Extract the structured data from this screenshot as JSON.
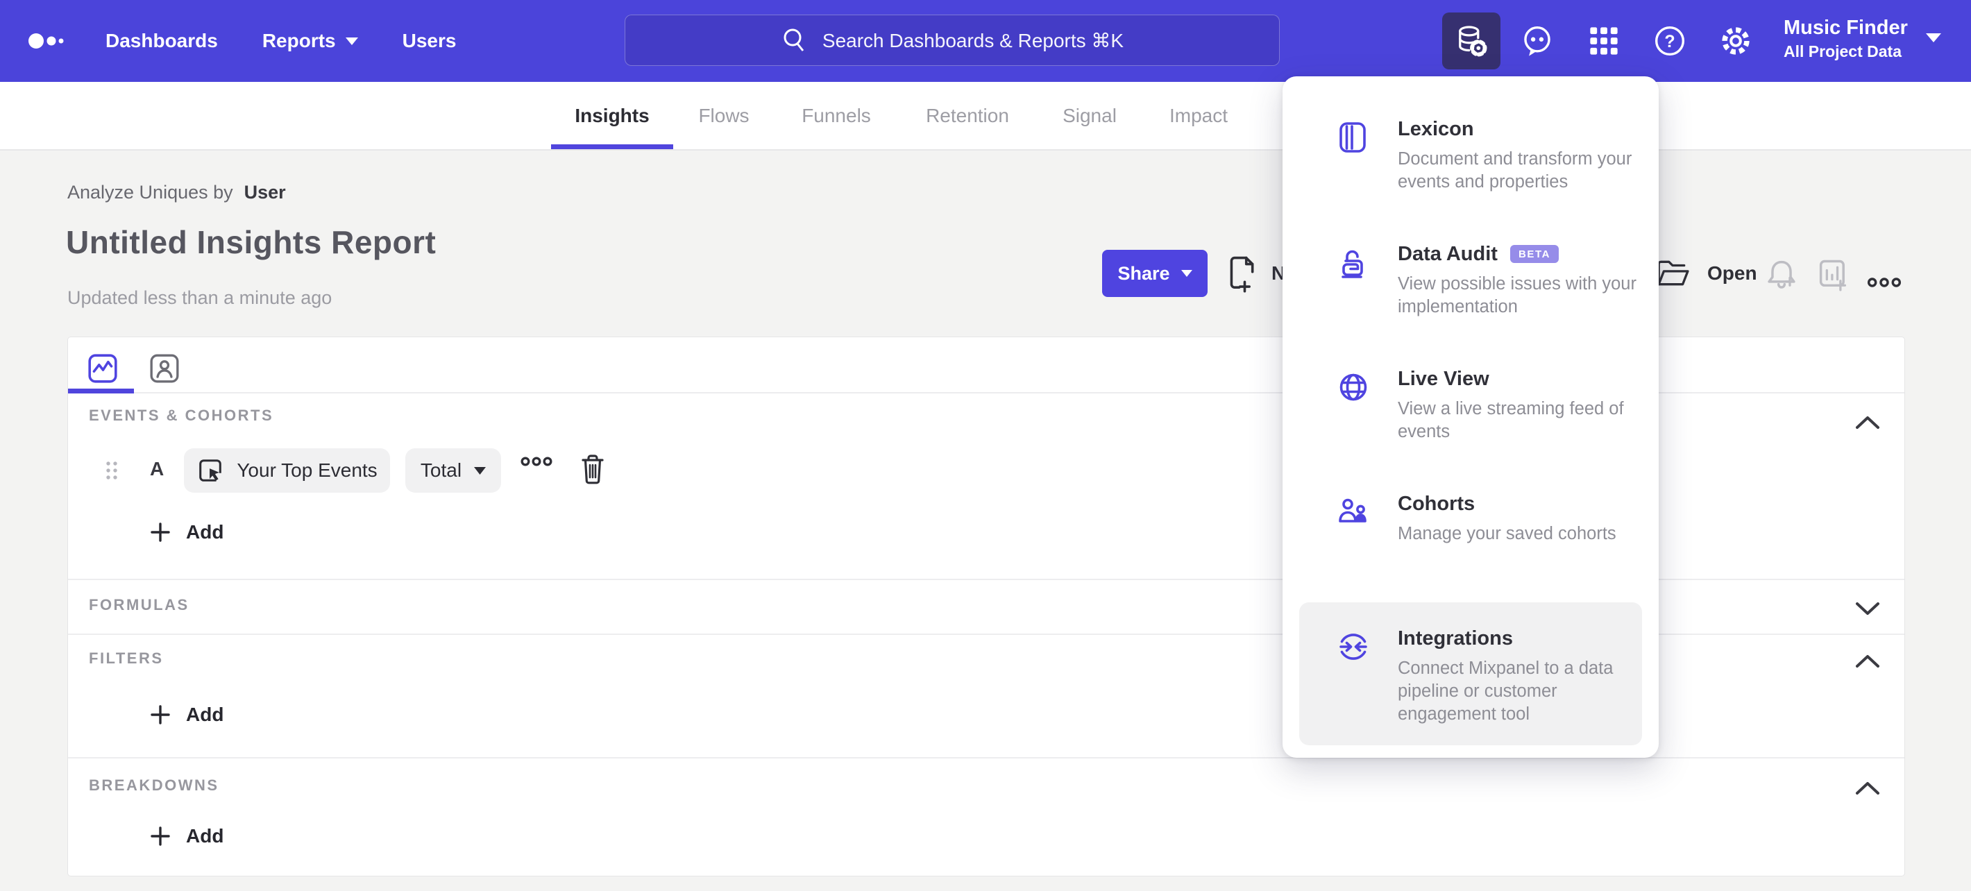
{
  "colors": {
    "navbar": "#4b44da",
    "accent": "#4f44e0",
    "active_tile": "#363070",
    "badge": "#968ce9",
    "page_bg": "#f3f3f2"
  },
  "navbar": {
    "links": [
      {
        "label": "Dashboards"
      },
      {
        "label": "Reports"
      },
      {
        "label": "Users"
      }
    ],
    "search_placeholder": "Search Dashboards & Reports ⌘K",
    "project": {
      "name": "Music Finder",
      "scope": "All Project Data"
    }
  },
  "tabs": [
    {
      "label": "Insights",
      "active": true
    },
    {
      "label": "Flows"
    },
    {
      "label": "Funnels"
    },
    {
      "label": "Retention"
    },
    {
      "label": "Signal"
    },
    {
      "label": "Impact"
    }
  ],
  "report": {
    "analyze_prefix": "Analyze Uniques by",
    "analyze_value": "User",
    "title": "Untitled Insights Report",
    "updated": "Updated less than a minute ago",
    "share_label": "Share",
    "new_label": "New",
    "open_label": "Open"
  },
  "builder": {
    "events_label": "EVENTS & COHORTS",
    "formulas_label": "FORMULAS",
    "filters_label": "FILTERS",
    "breakdowns_label": "BREAKDOWNS",
    "add_label": "Add",
    "event_row": {
      "letter": "A",
      "event_name": "Your Top Events",
      "aggregation": "Total"
    }
  },
  "data_menu": {
    "items": [
      {
        "title": "Lexicon",
        "description": "Document and transform your events and properties"
      },
      {
        "title": "Data Audit",
        "badge": "BETA",
        "description": "View possible issues with your implementation"
      },
      {
        "title": "Live View",
        "description": "View a live streaming feed of events"
      },
      {
        "title": "Cohorts",
        "description": "Manage your saved cohorts"
      },
      {
        "title": "Integrations",
        "description": "Connect Mixpanel to a data pipeline or customer engagement tool",
        "highlighted": true
      }
    ]
  }
}
